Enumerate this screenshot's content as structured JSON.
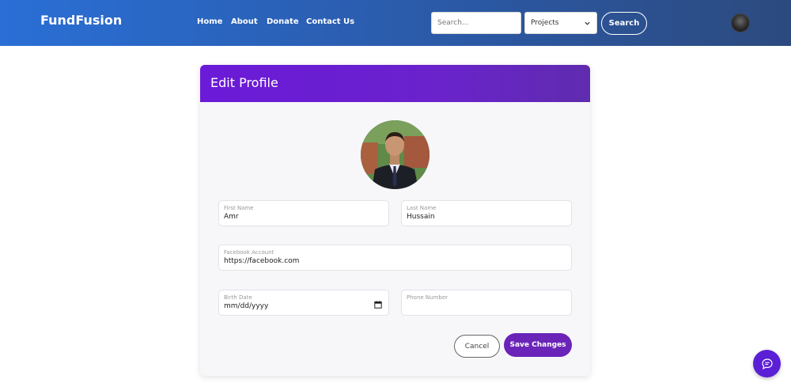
{
  "navbar": {
    "brand": "FundFusion",
    "links": [
      "Home",
      "About",
      "Donate",
      "Contact Us"
    ],
    "search_placeholder": "Search...",
    "category_select": "Projects",
    "search_button": "Search"
  },
  "profile_form": {
    "title": "Edit Profile",
    "first_name": {
      "label": "First Name",
      "value": "Amr"
    },
    "last_name": {
      "label": "Last Name",
      "value": "Hussain"
    },
    "facebook": {
      "label": "Facebook Account",
      "value": "https://facebook.com"
    },
    "birth_date": {
      "label": "Birth Date",
      "value": "mm/dd/yyyy"
    },
    "phone": {
      "label": "Phone Number",
      "value": ""
    },
    "cancel_button": "Cancel",
    "save_button": "Save Changes"
  },
  "colors": {
    "accent": "#6a24b8",
    "header": "#6b1ad8",
    "navbar": "#2a6fd6"
  },
  "icons": {
    "calendar": "calendar-icon",
    "chevron": "chevron-down-icon",
    "chat": "chat-bubble-icon"
  }
}
